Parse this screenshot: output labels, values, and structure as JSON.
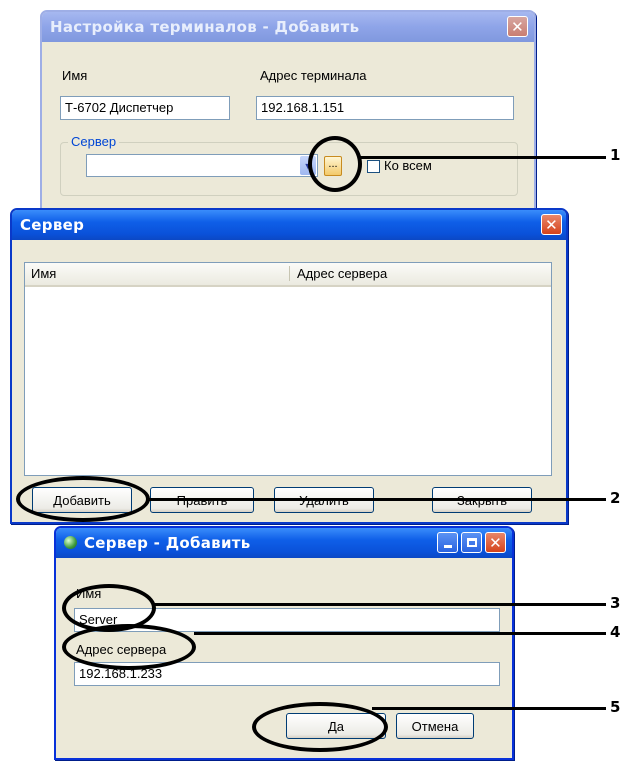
{
  "terminal_window": {
    "title": "Настройка терминалов - Добавить",
    "name_label": "Имя",
    "name_value": "Т-6702 Диспетчер",
    "address_label": "Адрес терминала",
    "address_value": "192.168.1.151",
    "server_group_label": "Сервер",
    "server_value": "",
    "browse_label": "...",
    "to_all_label": "Ко всем"
  },
  "server_window": {
    "title": "Сервер",
    "columns": [
      "Имя",
      "Адрес сервера"
    ],
    "rows": [],
    "buttons": {
      "add": "Добавить",
      "edit": "Править",
      "delete": "Удалить",
      "close": "Закрыть"
    }
  },
  "add_server_window": {
    "title": "Сервер - Добавить",
    "name_label": "Имя",
    "name_value": "Server",
    "address_label": "Адрес сервера",
    "address_value": "192.168.1.233",
    "ok_label": "Да",
    "cancel_label": "Отмена"
  },
  "callouts": [
    "1",
    "2",
    "3",
    "4",
    "5"
  ],
  "colors": {
    "titlebar_active": "#0a51d9",
    "titlebar_inactive": "#8ea4e8",
    "window_face": "#ece9d8",
    "close_button": "#d5431c"
  }
}
